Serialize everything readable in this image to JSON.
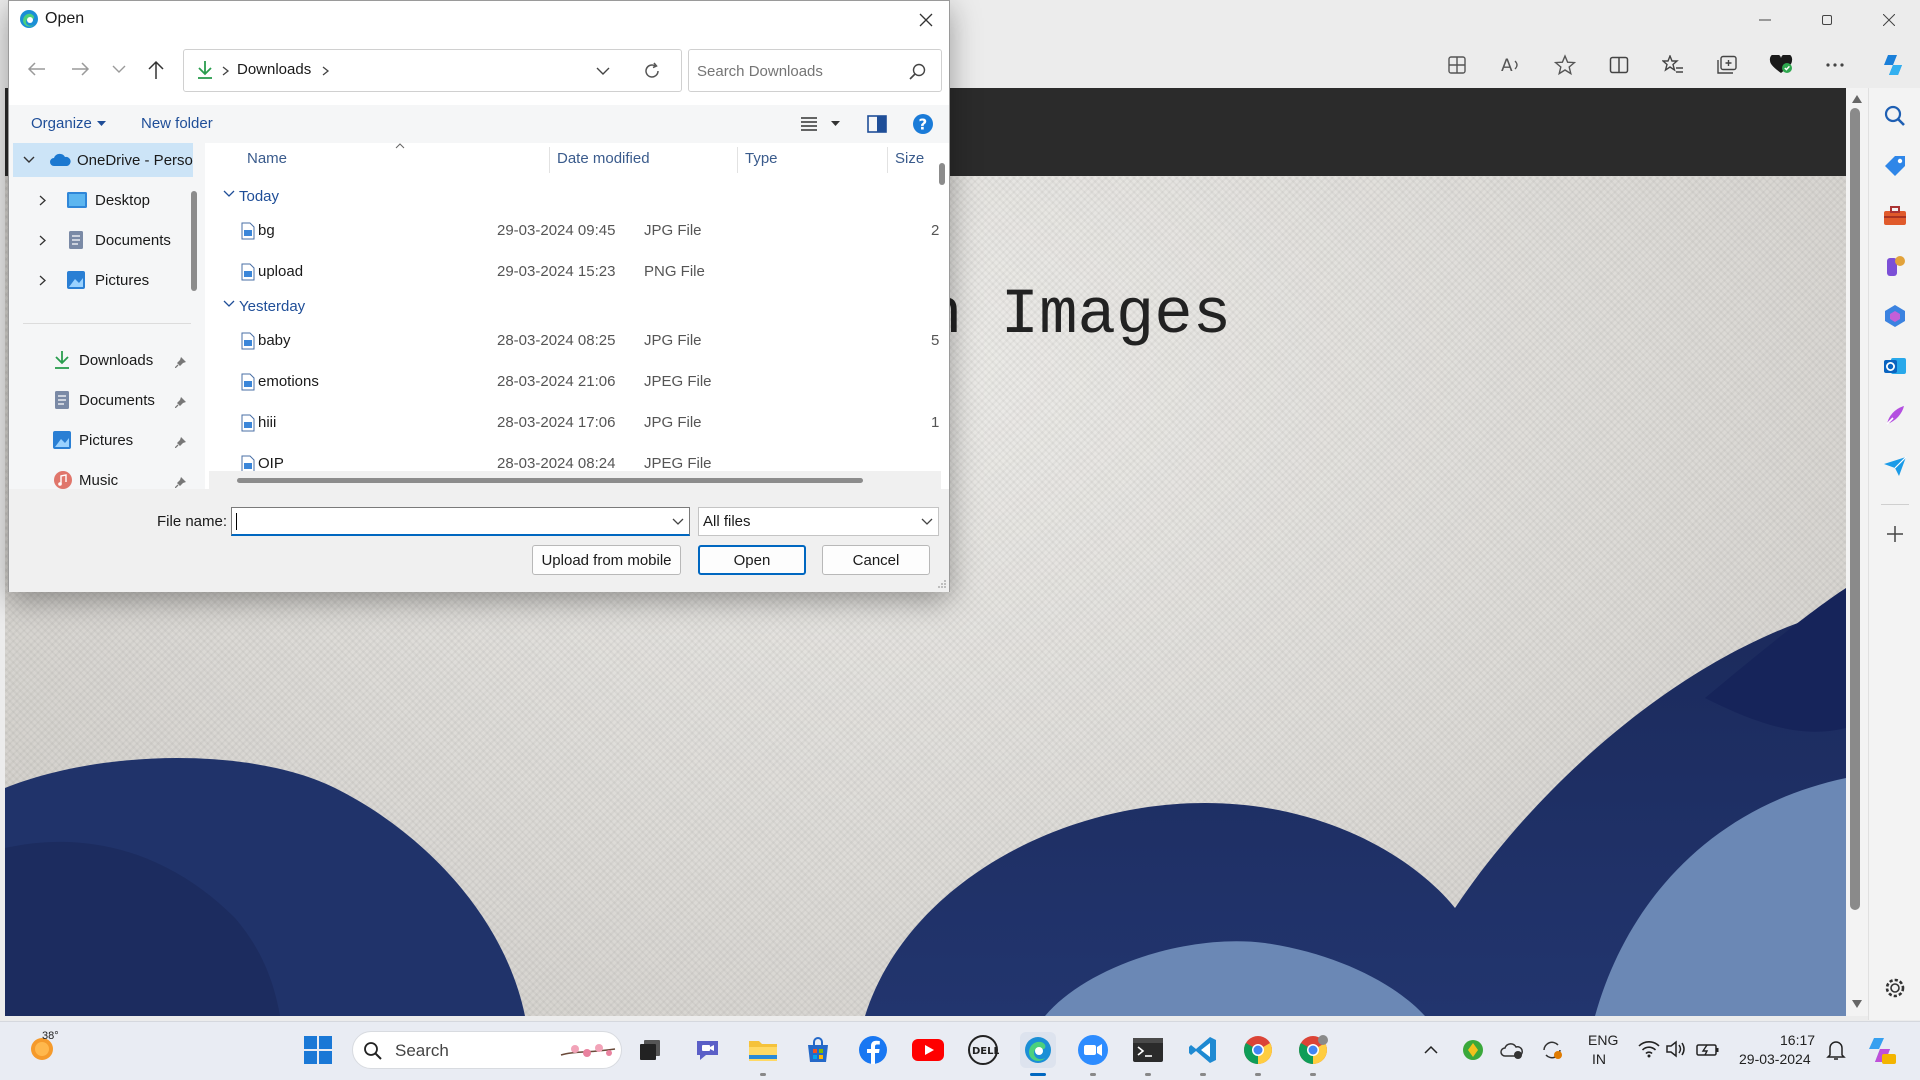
{
  "browser": {
    "page_heading": "sions on Images"
  },
  "dialog": {
    "title": "Open",
    "breadcrumb": [
      "Downloads"
    ],
    "search_placeholder": "Search Downloads",
    "organize_label": "Organize",
    "new_folder_label": "New folder",
    "nav": {
      "tree": [
        {
          "label": "OneDrive - Perso",
          "expanded": true
        },
        {
          "label": "Desktop"
        },
        {
          "label": "Documents"
        },
        {
          "label": "Pictures"
        }
      ],
      "quick_access": [
        {
          "label": "Downloads",
          "pinned": true
        },
        {
          "label": "Documents",
          "pinned": true
        },
        {
          "label": "Pictures",
          "pinned": true
        },
        {
          "label": "Music",
          "pinned": true
        }
      ]
    },
    "columns": {
      "name": "Name",
      "date": "Date modified",
      "type": "Type",
      "size": "Size"
    },
    "groups": [
      {
        "label": "Today",
        "files": [
          {
            "name": "bg",
            "date": "29-03-2024 09:45",
            "type": "JPG File",
            "size": "2"
          },
          {
            "name": "upload",
            "date": "29-03-2024 15:23",
            "type": "PNG File",
            "size": ""
          }
        ]
      },
      {
        "label": "Yesterday",
        "files": [
          {
            "name": "baby",
            "date": "28-03-2024 08:25",
            "type": "JPG File",
            "size": "5"
          },
          {
            "name": "emotions",
            "date": "28-03-2024 21:06",
            "type": "JPEG File",
            "size": ""
          },
          {
            "name": "hiii",
            "date": "28-03-2024 17:06",
            "type": "JPG File",
            "size": "1"
          },
          {
            "name": "OIP",
            "date": "28-03-2024 08:24",
            "type": "JPEG File",
            "size": ""
          }
        ]
      }
    ],
    "file_name_label": "File name:",
    "file_name_value": "",
    "filter_value": "All files",
    "upload_label": "Upload from mobile",
    "open_label": "Open",
    "cancel_label": "Cancel"
  },
  "taskbar": {
    "weather_temp": "38°",
    "search_label": "Search",
    "lang_top": "ENG",
    "lang_bottom": "IN",
    "time": "16:17",
    "date": "29-03-2024"
  },
  "colors": {
    "accent": "#0067c0",
    "folder_link": "#1f4e98",
    "page_dark_band": "#2b2b2b",
    "wave_dark": "#1e2f62",
    "wave_light": "#5a7aa8"
  }
}
